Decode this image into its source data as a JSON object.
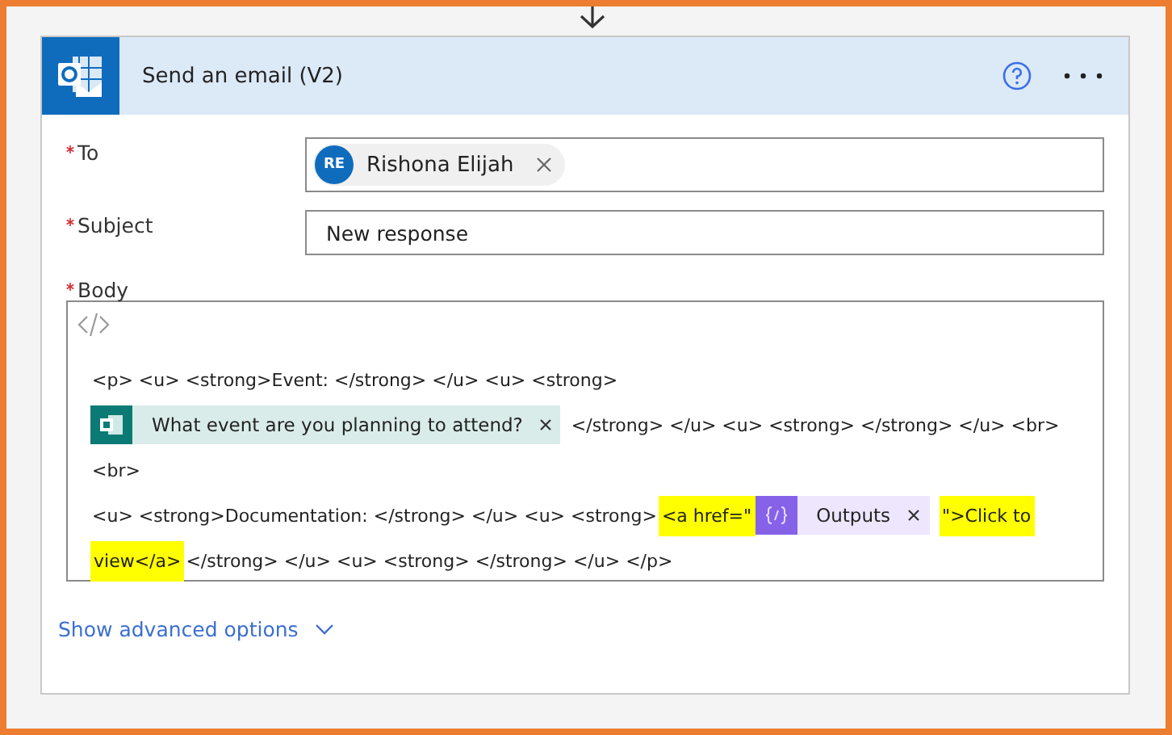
{
  "action": {
    "title": "Send an email (V2)"
  },
  "fields": [
    {
      "label": "To",
      "required": true,
      "kind": "people",
      "chips": [
        {
          "initials": "RE",
          "name": "Rishona Elijah"
        }
      ]
    },
    {
      "label": "Subject",
      "required": true,
      "kind": "text",
      "value": "New response"
    }
  ],
  "body": {
    "label": "Body",
    "required": true,
    "lines": [
      [
        {
          "kind": "text",
          "text": "<p> <u> <strong>Event: </strong> </u> <u> <strong>"
        }
      ],
      [
        {
          "kind": "forms-token",
          "text": "What event are you planning to attend?"
        },
        {
          "kind": "text",
          "text": "</strong> </u> <u> <strong> </strong> </u> <br>"
        }
      ],
      [
        {
          "kind": "text",
          "text": "<br>"
        }
      ],
      [
        {
          "kind": "text",
          "text": "<u> <strong>Documentation: </strong> </u> <u> <strong>"
        },
        {
          "kind": "highlight",
          "text": "<a href=\""
        },
        {
          "kind": "expression-token",
          "text": "Outputs"
        },
        {
          "kind": "highlight",
          "text": "\">Click to"
        }
      ],
      [
        {
          "kind": "highlight",
          "text": "view</a>"
        },
        {
          "kind": "text",
          "text": "</strong> </u> <u> <strong> </strong> </u> </p>"
        }
      ]
    ]
  },
  "advanced": {
    "label": "Show advanced options"
  }
}
